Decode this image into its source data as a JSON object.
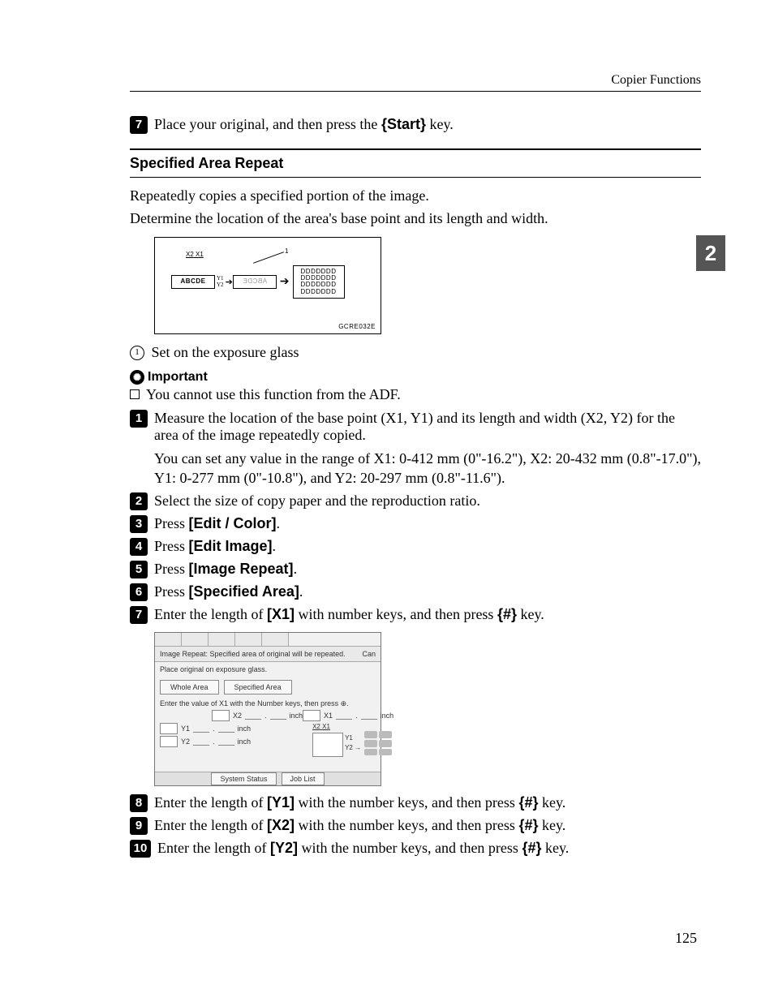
{
  "header": {
    "section": "Copier Functions"
  },
  "side_tab": "2",
  "page_number": "125",
  "pre_step": {
    "num": "7",
    "text_a": "Place your original, and then press the ",
    "key": "Start",
    "text_b": " key."
  },
  "section": {
    "title": "Specified Area Repeat",
    "intro1": "Repeatedly copies a specified portion of the image.",
    "intro2": "Determine the location of the area's base point and its length and width."
  },
  "diagram": {
    "x2": "X2",
    "x1": "X1",
    "y1": "Y1",
    "y2": "Y2",
    "abc": "ABCDE",
    "ddd": "DDDDDDD",
    "callout": "1",
    "code": "GCRE032E"
  },
  "callout_note": {
    "num": "1",
    "text": "Set on the exposure glass"
  },
  "important": {
    "label": "Important",
    "bullet": "You cannot use this function from the ADF."
  },
  "steps": {
    "s1": {
      "num": "1",
      "line": "Measure the location of the base point (X1, Y1) and its length and width (X2, Y2) for the area of the image repeatedly copied.",
      "detail": "You can set any value in the range of X1: 0-412 mm (0\"-16.2\"), X2: 20-432 mm (0.8\"-17.0\"), Y1: 0-277 mm (0\"-10.8\"), and Y2: 20-297 mm (0.8\"-11.6\")."
    },
    "s2": {
      "num": "2",
      "line": "Select the size of copy paper and the reproduction ratio."
    },
    "s3": {
      "num": "3",
      "pre": "Press ",
      "btn": "[Edit / Color]",
      "post": "."
    },
    "s4": {
      "num": "4",
      "pre": "Press ",
      "btn": "[Edit Image]",
      "post": "."
    },
    "s5": {
      "num": "5",
      "pre": "Press ",
      "btn": "[Image Repeat]",
      "post": "."
    },
    "s6": {
      "num": "6",
      "pre": "Press ",
      "btn": "[Specified Area]",
      "post": "."
    },
    "s7": {
      "num": "7",
      "a": "Enter the length of ",
      "btn": "[X1]",
      "b": " with number keys, and then press ",
      "key": "#",
      "c": " key."
    },
    "s8": {
      "num": "8",
      "a": "Enter the length of ",
      "btn": "[Y1]",
      "b": " with the number keys, and then press ",
      "key": "#",
      "c": " key."
    },
    "s9": {
      "num": "9",
      "a": "Enter the length of ",
      "btn": "[X2]",
      "b": " with the number keys, and then press ",
      "key": "#",
      "c": " key."
    },
    "s10": {
      "num": "10",
      "a": "Enter the length of ",
      "btn": "[Y2]",
      "b": " with the number keys, and then press ",
      "key": "#",
      "c": " key."
    }
  },
  "screenshot": {
    "status": "Image Repeat: Specified area of original will be repeated.",
    "cancel": "Can",
    "instr": "Place original on exposure glass.",
    "whole": "Whole Area",
    "spec": "Specified Area",
    "enter": "Enter the value of X1 with the Number keys, then press ⊕.",
    "x2": "X2",
    "x1": "X1",
    "y1": "Y1",
    "y2": "Y2",
    "inch": "inch",
    "sys": "System Status",
    "job": "Job List"
  }
}
